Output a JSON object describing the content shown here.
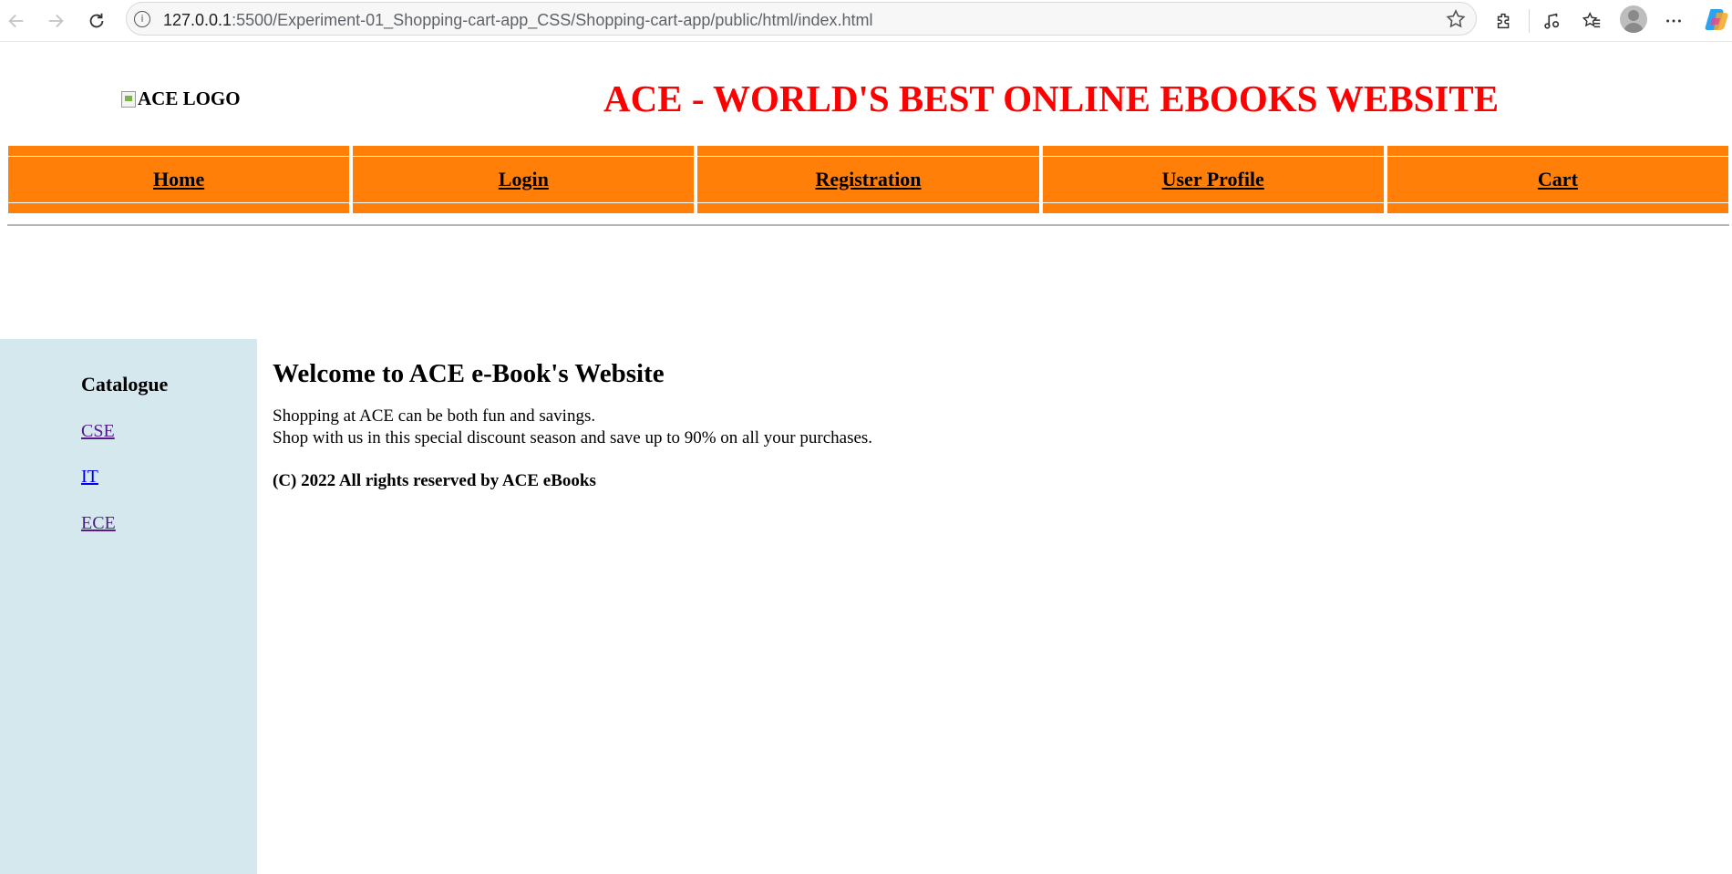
{
  "browser": {
    "url_host": "127.0.0.1",
    "url_rest": ":5500/Experiment-01_Shopping-cart-app_CSS/Shopping-cart-app/public/html/index.html",
    "icons": [
      "back-arrow-icon",
      "forward-arrow-icon",
      "reload-icon",
      "site-info-icon",
      "favorite-star-icon",
      "extensions-icon",
      "media-icon",
      "favorites-icon",
      "profile-icon",
      "more-icon",
      "copilot-icon"
    ]
  },
  "header": {
    "logo_alt": "ACE LOGO",
    "title": "ACE - WORLD'S BEST ONLINE EBOOKS WEBSITE",
    "title_color": "#ff0000"
  },
  "nav": {
    "bar_color": "#ff7f08",
    "items": [
      {
        "label": "Home"
      },
      {
        "label": "Login"
      },
      {
        "label": "Registration"
      },
      {
        "label": "User Profile"
      },
      {
        "label": "Cart"
      }
    ]
  },
  "sidebar": {
    "background": "#d5e8ee",
    "title": "Catalogue",
    "links": [
      {
        "label": "CSE"
      },
      {
        "label": "IT"
      },
      {
        "label": "ECE"
      }
    ]
  },
  "main": {
    "heading": "Welcome to ACE e-Book's Website",
    "line1": "Shopping at ACE can be both fun and savings.",
    "line2": "Shop with us in this special discount season and save up to 90% on all your purchases.",
    "copyright": "(C) 2022 All rights reserved by ACE eBooks"
  }
}
